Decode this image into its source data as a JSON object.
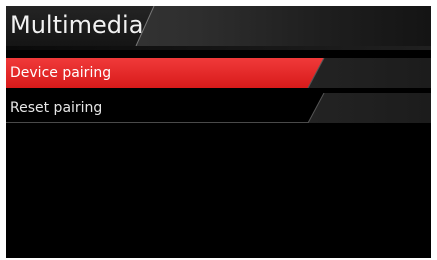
{
  "header": {
    "title": "Multimedia"
  },
  "menu": {
    "items": [
      {
        "label": "Device pairing",
        "state": "selected"
      },
      {
        "label": "Reset pairing",
        "state": "unselected"
      }
    ]
  },
  "colors": {
    "accent": "#e22a2a",
    "background": "#000000",
    "text": "#ffffff"
  }
}
